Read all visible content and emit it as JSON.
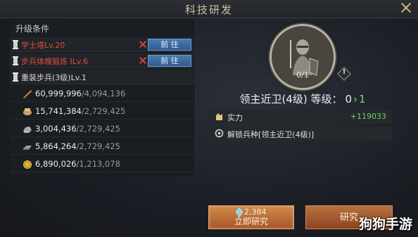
{
  "header": {
    "title": "科技研发"
  },
  "requirements": {
    "title": "升级条件",
    "items": [
      {
        "label": "学士塔Lv.20",
        "met": false,
        "button": "前 往"
      },
      {
        "label": "步兵体魄锻炼 ILv.6",
        "met": false,
        "button": "前 往"
      },
      {
        "label": "重装步兵(3级)Lv.1",
        "met": true
      }
    ]
  },
  "resources": [
    {
      "icon": "wood-icon",
      "have": "60,999,996",
      "need": "/4,094,136"
    },
    {
      "icon": "food-icon",
      "have": "15,741,384",
      "need": "/2,729,425"
    },
    {
      "icon": "stone-icon",
      "have": "3,004,436",
      "need": "/2,729,425"
    },
    {
      "icon": "iron-icon",
      "have": "5,864,264",
      "need": "/2,729,425"
    },
    {
      "icon": "gold-icon",
      "have": "6,890,026",
      "need": "/1,213,078"
    }
  ],
  "tech": {
    "progress": "0/1",
    "warning": "!",
    "name": "领主近卫(4级) 等级：",
    "current_level": "0",
    "arrow": "›",
    "next_level": "1"
  },
  "stats": [
    {
      "icon": "power-icon",
      "label": "实力",
      "value": "+119033"
    },
    {
      "icon": "unlock-icon",
      "label": "解锁兵种[领主近卫(4级)]",
      "value": ""
    }
  ],
  "actions": {
    "instant_cost": "2,384",
    "instant_label": "立即研究",
    "research_label": "研究"
  },
  "watermark": "狗狗手游",
  "colors": {
    "required_unmet": "#e04b3c",
    "bonus_green": "#6fd364",
    "go_button": "#3a6ba3",
    "action_button": "#b8723f"
  }
}
